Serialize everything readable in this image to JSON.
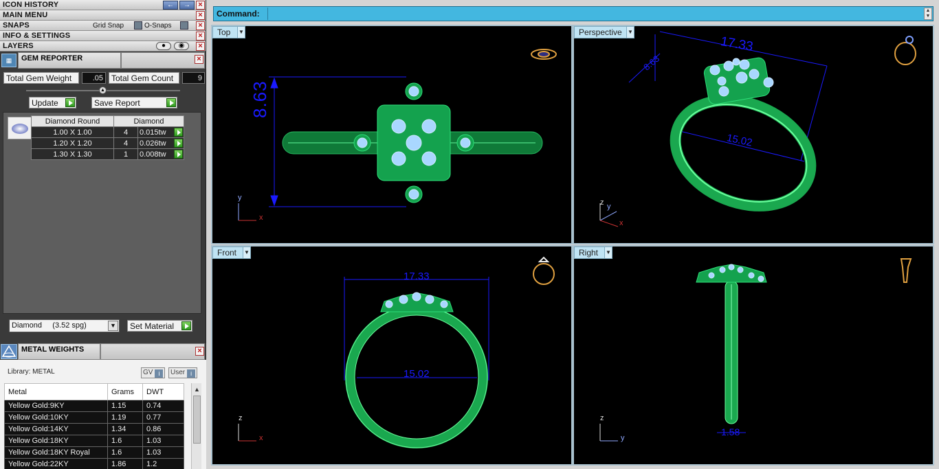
{
  "left_panel": {
    "bars": {
      "icon_history": "ICON HISTORY",
      "main_menu": "MAIN MENU",
      "snaps": "SNAPS",
      "grid_snap": "Grid Snap",
      "o_snaps": "O-Snaps",
      "info_settings": "INFO & SETTINGS",
      "layers": "LAYERS"
    },
    "gem_reporter": {
      "title": "GEM REPORTER",
      "total_weight_label": "Total Gem Weight",
      "total_weight_value": ".05",
      "total_count_label": "Total Gem Count",
      "total_count_value": "9",
      "update_label": "Update",
      "save_report_label": "Save Report",
      "table": {
        "headers": [
          "Diamond Round",
          "Diamond"
        ],
        "rows": [
          {
            "size": "1.00 X 1.00",
            "count": "4",
            "weight": "0.015tw"
          },
          {
            "size": "1.20 X 1.20",
            "count": "4",
            "weight": "0.026tw"
          },
          {
            "size": "1.30 X 1.30",
            "count": "1",
            "weight": "0.008tw"
          }
        ]
      },
      "material_value": "Diamond     (3.52 spg)",
      "set_material_label": "Set Material"
    },
    "metal_weights": {
      "title": "METAL WEIGHTS",
      "library_label": "Library: METAL",
      "gv_label": "GV",
      "user_label": "User",
      "headers": [
        "Metal",
        "Grams",
        "DWT"
      ],
      "rows": [
        {
          "metal": "Yellow Gold:9KY",
          "grams": "1.15",
          "dwt": "0.74"
        },
        {
          "metal": "Yellow Gold:10KY",
          "grams": "1.19",
          "dwt": "0.77"
        },
        {
          "metal": "Yellow Gold:14KY",
          "grams": "1.34",
          "dwt": "0.86"
        },
        {
          "metal": "Yellow Gold:18KY",
          "grams": "1.6",
          "dwt": "1.03"
        },
        {
          "metal": "Yellow Gold:18KY Royal",
          "grams": "1.6",
          "dwt": "1.03"
        },
        {
          "metal": "Yellow Gold:22KY",
          "grams": "1.86",
          "dwt": "1.2"
        }
      ]
    }
  },
  "command": {
    "label": "Command:",
    "value": ""
  },
  "viewports": {
    "top": {
      "label": "Top",
      "dim_height": "8.63",
      "axis_a": "y",
      "axis_b": "x"
    },
    "perspective": {
      "label": "Perspective",
      "dim_width": "17.33",
      "dim_depth": "8.63",
      "dim_inner": "15.02",
      "axis_a": "z",
      "axis_b": "y",
      "axis_c": "x"
    },
    "front": {
      "label": "Front",
      "dim_width": "17.33",
      "dim_inner": "15.02",
      "axis_a": "z",
      "axis_b": "x"
    },
    "right": {
      "label": "Right",
      "dim_band": "1.58",
      "axis_a": "z",
      "axis_b": "y"
    }
  },
  "colors": {
    "model_green": "#2fcf6a",
    "dimension_blue": "#1a1aff",
    "command_bar": "#43b7e0"
  }
}
